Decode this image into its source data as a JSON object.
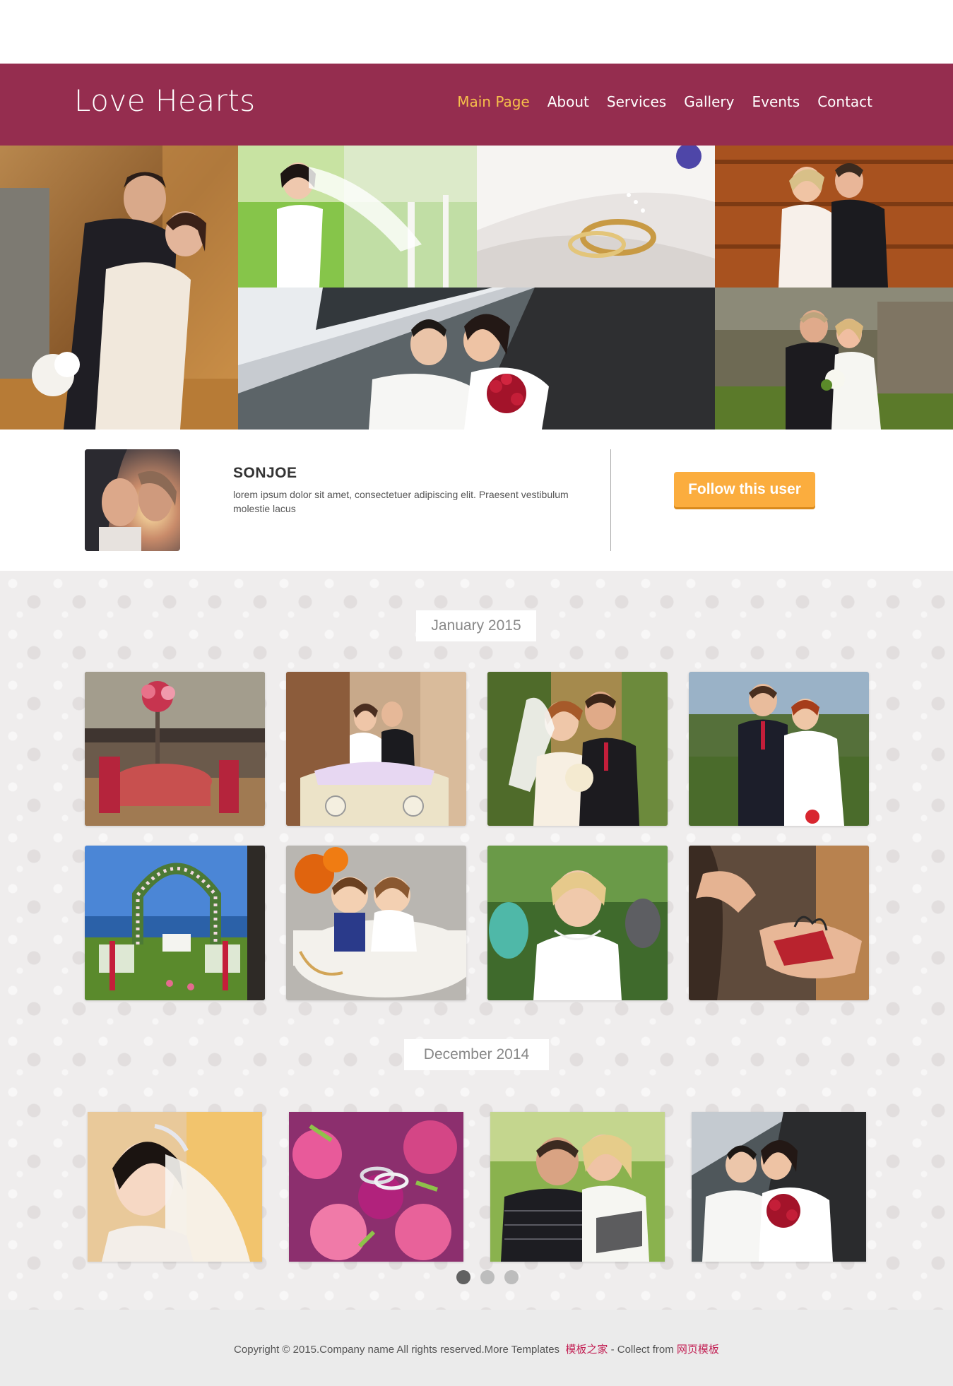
{
  "header": {
    "logo": "Love Hearts",
    "nav": [
      {
        "label": "Main Page",
        "active": true
      },
      {
        "label": "About"
      },
      {
        "label": "Services"
      },
      {
        "label": "Gallery"
      },
      {
        "label": "Events"
      },
      {
        "label": "Contact"
      }
    ]
  },
  "profile": {
    "name": "SONJOE",
    "bio": "lorem ipsum dolor sit amet, consectetuer adipiscing elit. Praesent vestibulum molestie lacus",
    "follow_label": "Follow this user"
  },
  "gallery": {
    "sections": [
      {
        "label": "January 2015"
      },
      {
        "label": "December 2014"
      }
    ]
  },
  "pagination": {
    "current_page": 1
  },
  "footer": {
    "text": "Copyright © 2015.Company name All rights reserved.More Templates",
    "link1": "模板之家",
    "separator": " - Collect from ",
    "link2": "网页模板"
  },
  "colors": {
    "header_bg": "#952d4f",
    "nav_active": "#f6c04b",
    "button_bg": "#fbad3e",
    "footer_link": "#c21f53"
  }
}
